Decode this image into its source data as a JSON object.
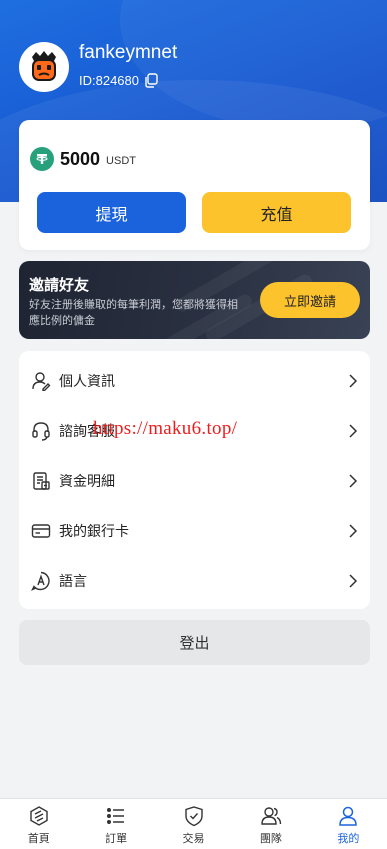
{
  "profile": {
    "username": "fankeymnet",
    "user_id": "ID:824680"
  },
  "balance": {
    "amount": "5000",
    "unit": "USDT",
    "withdraw_label": "提現",
    "recharge_label": "充值"
  },
  "invite": {
    "title": "邀請好友",
    "description": "好友注册後賺取的每筆利潤，您都將獲得相應比例的傭金",
    "button_label": "立即邀請"
  },
  "menu": {
    "items": [
      {
        "label": "個人資訊",
        "icon": "user-icon"
      },
      {
        "label": "諮詢客服",
        "icon": "headset-icon"
      },
      {
        "label": "資金明細",
        "icon": "ledger-icon"
      },
      {
        "label": "我的銀行卡",
        "icon": "bank-card-icon"
      },
      {
        "label": "語言",
        "icon": "language-icon"
      }
    ]
  },
  "watermark": "https://maku6.top/",
  "logout_label": "登出",
  "bottom_nav": {
    "items": [
      {
        "label": "首頁",
        "icon": "home-icon"
      },
      {
        "label": "訂單",
        "icon": "orders-icon"
      },
      {
        "label": "交易",
        "icon": "trade-icon"
      },
      {
        "label": "團隊",
        "icon": "team-icon"
      },
      {
        "label": "我的",
        "icon": "profile-icon"
      }
    ],
    "active_index": 4
  },
  "colors": {
    "brand_blue": "#1b63dd",
    "accent_yellow": "#fcc32c",
    "usdt_green": "#26a17b",
    "watermark_red": "#ee1c1c"
  }
}
